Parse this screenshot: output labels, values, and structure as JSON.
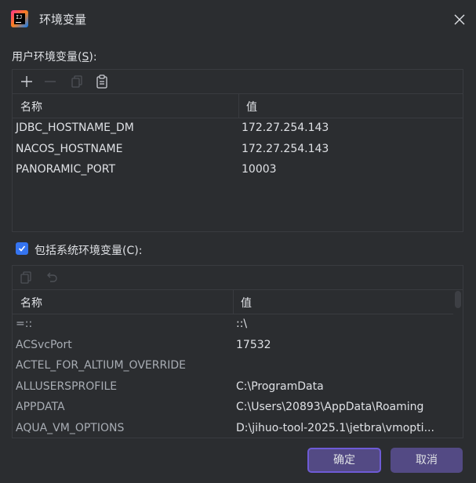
{
  "window": {
    "title": "环境变量",
    "close_icon": "close-icon"
  },
  "user_section": {
    "label_prefix": "用户环境变量(",
    "label_mnemonic": "S",
    "label_suffix": "):",
    "columns": [
      "名称",
      "值"
    ],
    "rows": [
      {
        "name": "JDBC_HOSTNAME_DM",
        "value": "172.27.254.143"
      },
      {
        "name": "NACOS_HOSTNAME",
        "value": "172.27.254.143"
      },
      {
        "name": "PANORAMIC_PORT",
        "value": "10003"
      }
    ]
  },
  "system_section": {
    "checkbox_label": "包括系统环境变量(C):",
    "checked": true,
    "columns": [
      "名称",
      "值"
    ],
    "rows": [
      {
        "name": "=::",
        "value": "::\\"
      },
      {
        "name": "ACSvcPort",
        "value": "17532"
      },
      {
        "name": "ACTEL_FOR_ALTIUM_OVERRIDE",
        "value": ""
      },
      {
        "name": "ALLUSERSPROFILE",
        "value": "C:\\ProgramData"
      },
      {
        "name": "APPDATA",
        "value": "C:\\Users\\20893\\AppData\\Roaming"
      },
      {
        "name": "AQUA_VM_OPTIONS",
        "value": "D:\\jihuo-tool-2025.1\\jetbra\\vmopti..."
      }
    ]
  },
  "buttons": {
    "ok": "确定",
    "cancel": "取消"
  },
  "colors": {
    "background": "#2b2d30",
    "accent": "#534a84",
    "focus_border": "#6e5bd6",
    "checkbox": "#3574f0"
  }
}
